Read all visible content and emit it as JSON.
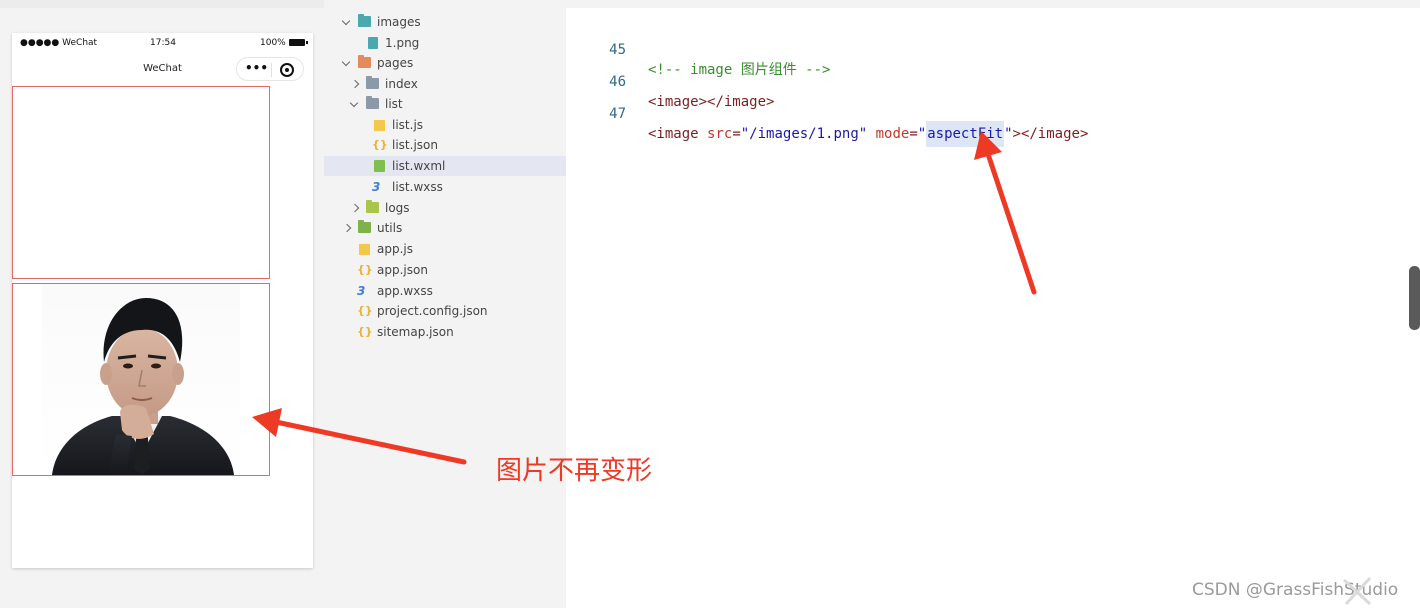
{
  "simulator": {
    "status_bar": {
      "carrier": "●●●●● WeChat",
      "time": "17:54",
      "battery": "100%"
    },
    "nav": {
      "title": "WeChat",
      "more_icon": "more-dots-icon",
      "close_icon": "target-circle-icon"
    }
  },
  "explorer": {
    "items": [
      {
        "label": "images"
      },
      {
        "label": "1.png"
      },
      {
        "label": "pages"
      },
      {
        "label": "index"
      },
      {
        "label": "list"
      },
      {
        "label": "list.js"
      },
      {
        "label": "list.json"
      },
      {
        "label": "list.wxml"
      },
      {
        "label": "list.wxss"
      },
      {
        "label": "logs"
      },
      {
        "label": "utils"
      },
      {
        "label": "app.js"
      },
      {
        "label": "app.json"
      },
      {
        "label": "app.wxss"
      },
      {
        "label": "project.config.json"
      },
      {
        "label": "sitemap.json"
      }
    ],
    "selected": "list.wxml"
  },
  "editor": {
    "lines": [
      {
        "num": "45",
        "comment": "<!-- image 图片组件 -->"
      },
      {
        "num": "46",
        "open": "<image>",
        "close": "</image>"
      },
      {
        "num": "47",
        "open": "<image ",
        "attr1": "src",
        "eq1": "=",
        "val1": "\"/images/1.png\"",
        "attr2": "mode",
        "eq2": "=",
        "q1": "\"",
        "val2": "aspectFit",
        "q2": "\"",
        "end": "></image>"
      }
    ]
  },
  "annotation": {
    "text": "图片不再变形",
    "color": "#ee3a24"
  },
  "watermark": {
    "text": "CSDN @GrassFishStudio"
  }
}
